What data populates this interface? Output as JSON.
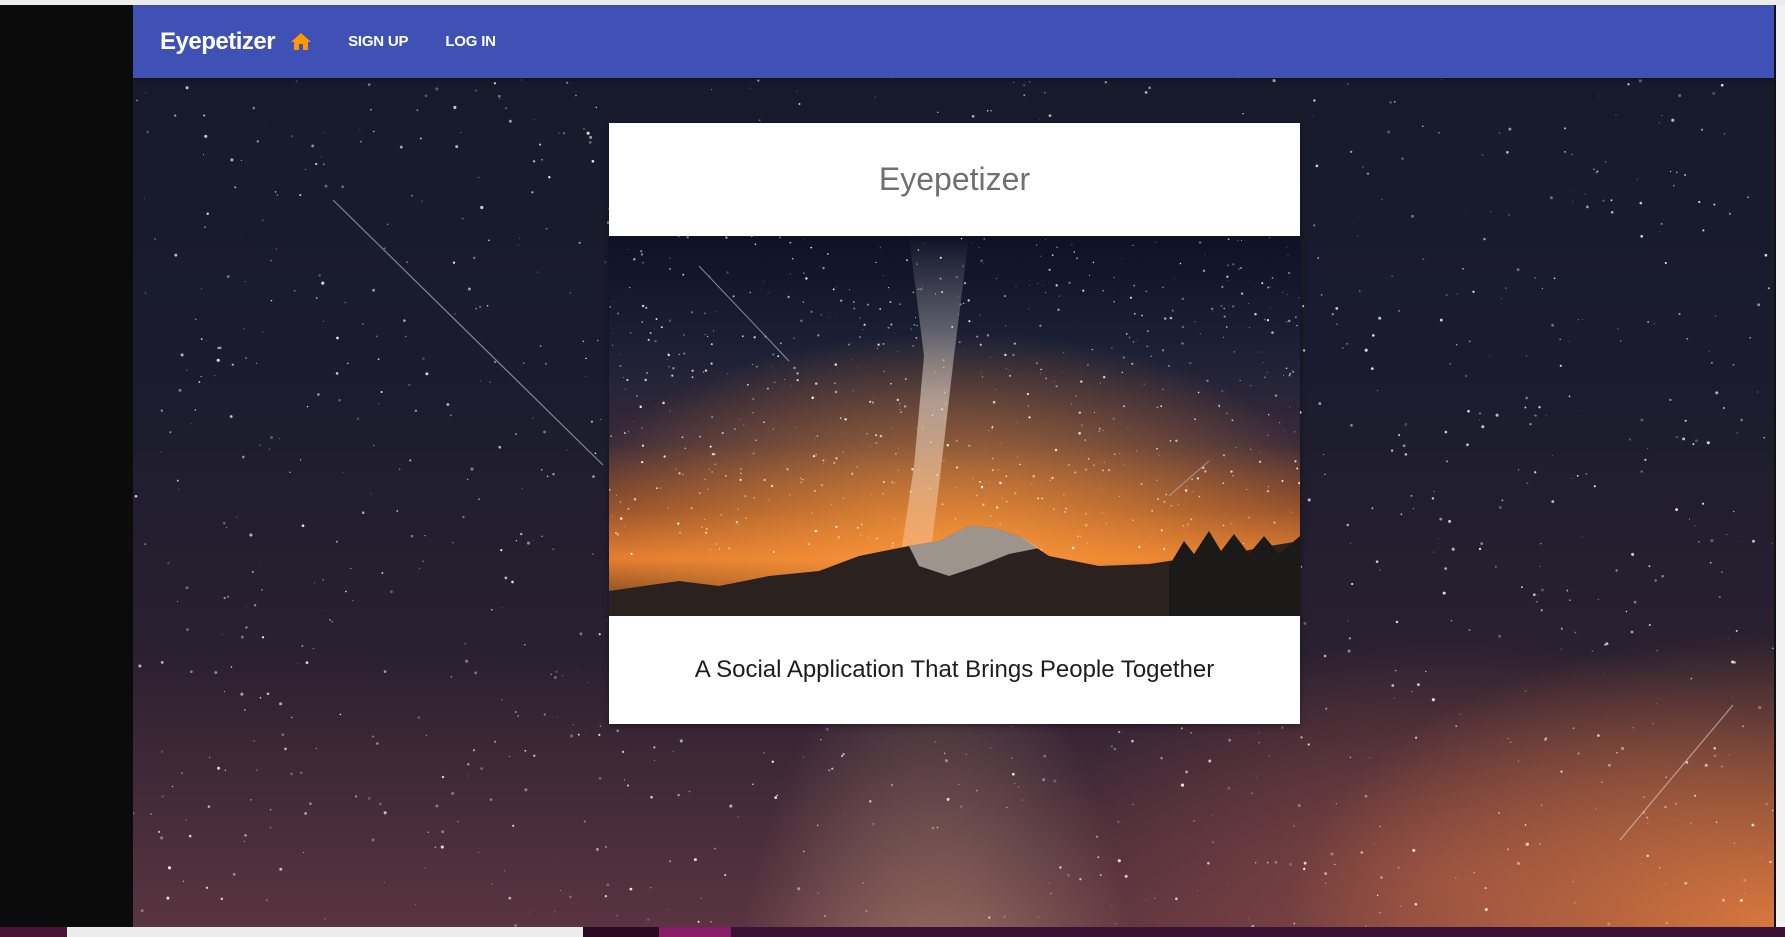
{
  "navbar": {
    "brand": "Eyepetizer",
    "home_icon": "home-icon",
    "links": [
      {
        "label": "SIGN UP"
      },
      {
        "label": "LOG IN"
      }
    ]
  },
  "card": {
    "title": "Eyepetizer",
    "image": "milky-way-over-mountain",
    "caption": "A Social Application That Brings People Together"
  },
  "colors": {
    "navbar": "#3f51b5",
    "home_icon": "#ff9800",
    "card_title": "#707070",
    "card_caption": "#1d1d1d"
  }
}
